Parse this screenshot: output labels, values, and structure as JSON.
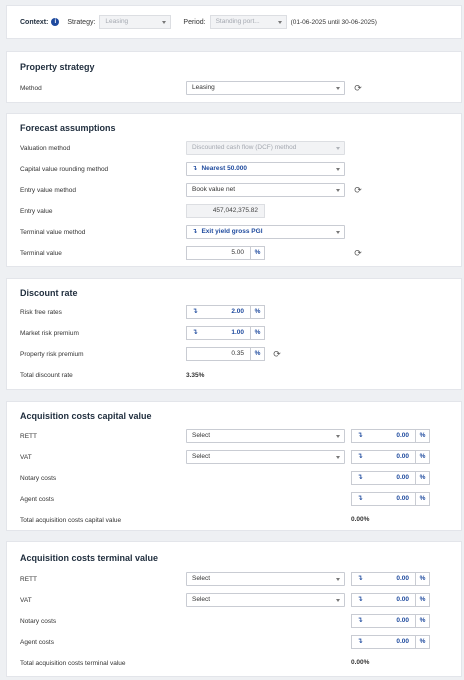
{
  "context": {
    "label": "Context:",
    "strategy_label": "Strategy:",
    "strategy_value": "Leasing",
    "period_label": "Period:",
    "period_value": "Standing port...",
    "period_range": "(01-06-2025 until 30-06-2025)"
  },
  "property_strategy": {
    "title": "Property strategy",
    "method_label": "Method",
    "method_value": "Leasing"
  },
  "forecast": {
    "title": "Forecast assumptions",
    "valuation_method_label": "Valuation method",
    "valuation_method_value": "Discounted cash flow (DCF) method",
    "rounding_label": "Capital value rounding method",
    "rounding_value": "Nearest 50.000",
    "entry_method_label": "Entry value method",
    "entry_method_value": "Book value net",
    "entry_value_label": "Entry value",
    "entry_value": "457,042,375.82",
    "terminal_method_label": "Terminal value method",
    "terminal_method_value": "Exit yield gross PGI",
    "terminal_value_label": "Terminal value",
    "terminal_value": "5.00",
    "unit": "%"
  },
  "discount": {
    "title": "Discount rate",
    "risk_free_label": "Risk free rates",
    "risk_free_value": "2.00",
    "market_label": "Market risk premium",
    "market_value": "1.00",
    "property_label": "Property risk premium",
    "property_value": "0.35",
    "total_label": "Total discount rate",
    "total_value": "3.35%",
    "unit": "%"
  },
  "acq_capital": {
    "title": "Acquisition costs capital value",
    "rett_label": "RETT",
    "rett_select": "Select",
    "rett_value": "0.00",
    "vat_label": "VAT",
    "vat_select": "Select",
    "vat_value": "0.00",
    "notary_label": "Notary costs",
    "notary_value": "0.00",
    "agent_label": "Agent costs",
    "agent_value": "0.00",
    "total_label": "Total acquisition costs capital value",
    "total_value": "0.00%",
    "unit": "%"
  },
  "acq_terminal": {
    "title": "Acquisition costs terminal value",
    "rett_label": "RETT",
    "rett_select": "Select",
    "rett_value": "0.00",
    "vat_label": "VAT",
    "vat_select": "Select",
    "vat_value": "0.00",
    "notary_label": "Notary costs",
    "notary_value": "0.00",
    "agent_label": "Agent costs",
    "agent_value": "0.00",
    "total_label": "Total acquisition costs terminal value",
    "total_value": "0.00%",
    "unit": "%"
  },
  "icons": {
    "info": "i",
    "refresh": "⟳",
    "arrow": "↴"
  },
  "colors": {
    "accent": "#1e4a9e",
    "border": "#c9ccd3",
    "disabled_bg": "#f2f3f5"
  }
}
